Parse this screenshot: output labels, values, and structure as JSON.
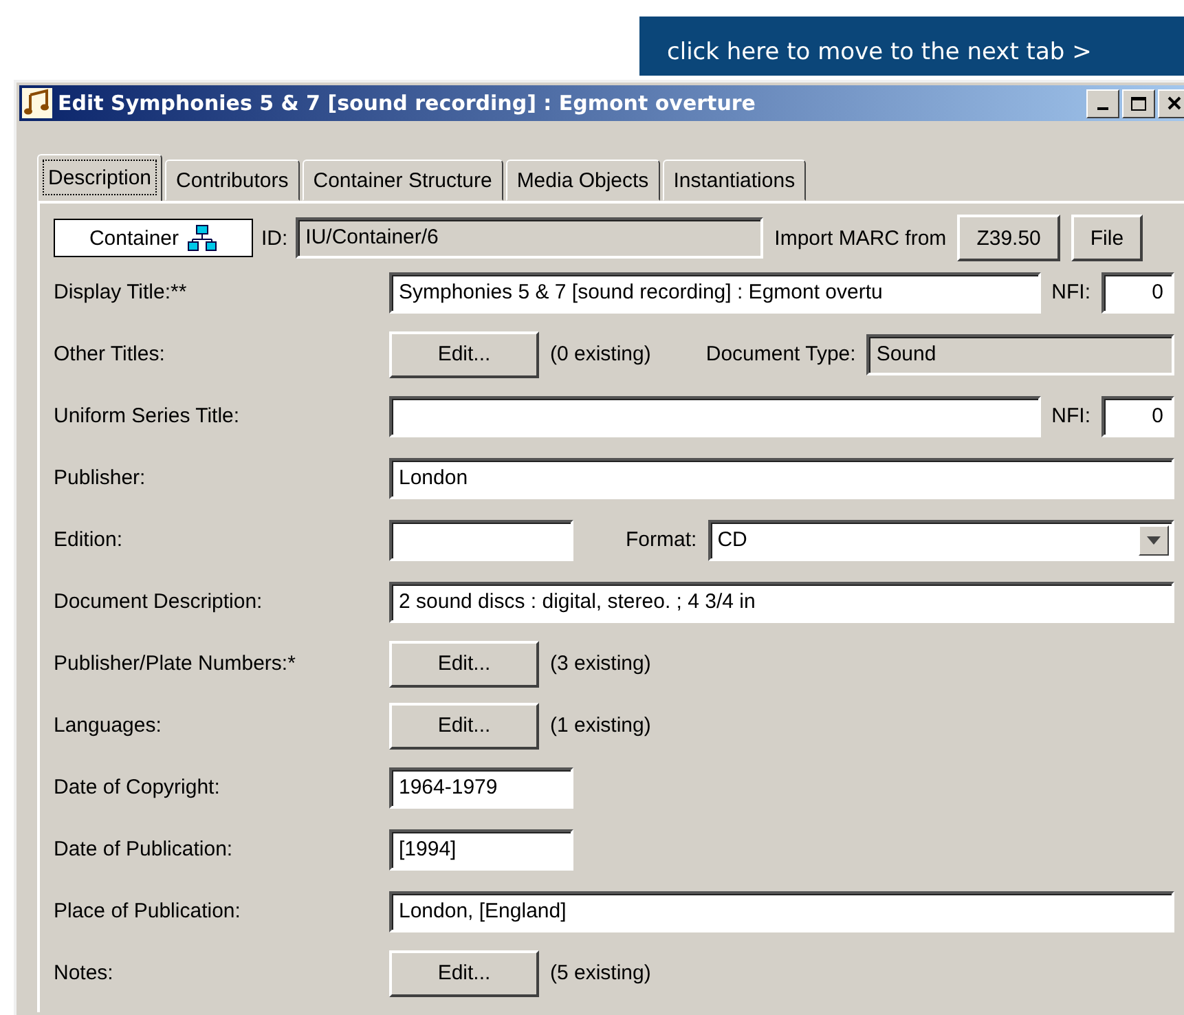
{
  "banner": {
    "label": "click here to move to the next tab >"
  },
  "window": {
    "title": "Edit Symphonies 5 & 7 [sound recording] : Egmont overture"
  },
  "tabs": [
    {
      "label": "Description",
      "selected": true
    },
    {
      "label": "Contributors",
      "selected": false
    },
    {
      "label": "Container Structure",
      "selected": false
    },
    {
      "label": "Media Objects",
      "selected": false
    },
    {
      "label": "Instantiations",
      "selected": false
    }
  ],
  "header": {
    "type_label": "Container",
    "id_label": "ID:",
    "id_value": "IU/Container/6",
    "import_label": "Import MARC from",
    "buttons": [
      "Z39.50",
      "File"
    ]
  },
  "rows": [
    {
      "kind": "text_nfi",
      "label": "Display Title:**",
      "value": "Symphonies 5 & 7 [sound recording] : Egmont overtu",
      "nfi_label": "NFI:",
      "nfi_value": "0"
    },
    {
      "kind": "button",
      "label": "Other Titles:",
      "button": "Edit...",
      "count": "(0 existing)",
      "extra_label": "Document Type:",
      "extra_value": "Sound"
    },
    {
      "kind": "text_nfi",
      "label": "Uniform Series Title:",
      "nfi_label": "NFI:",
      "nfi_value": "0"
    },
    {
      "kind": "text",
      "label": "Publisher:",
      "value": "London"
    },
    {
      "kind": "text_select",
      "label": "Edition:",
      "select_label": "Format:",
      "select_value": "CD"
    },
    {
      "kind": "text",
      "label": "Document Description:",
      "value": "2 sound discs : digital, stereo. ; 4 3/4 in"
    },
    {
      "kind": "button",
      "label": "Publisher/Plate Numbers:*",
      "button": "Edit...",
      "count": "(3 existing)"
    },
    {
      "kind": "button",
      "label": "Languages:",
      "button": "Edit...",
      "count": "(1 existing)"
    },
    {
      "kind": "short",
      "label": "Date of Copyright:",
      "value": "1964-1979"
    },
    {
      "kind": "short",
      "label": "Date of Publication:",
      "value": "[1994]"
    },
    {
      "kind": "text",
      "label": "Place of Publication:",
      "value": "London, [England]"
    },
    {
      "kind": "button",
      "label": "Notes:",
      "button": "Edit...",
      "count": "(5 existing)"
    }
  ]
}
